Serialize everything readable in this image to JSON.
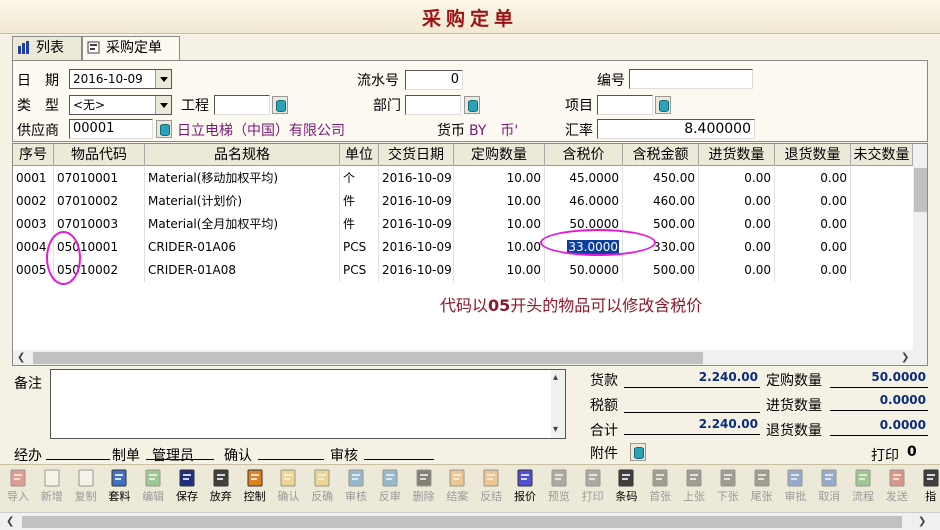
{
  "window": {
    "title": "采购定单"
  },
  "tabs": [
    {
      "label": "列表"
    },
    {
      "label": "采购定单"
    }
  ],
  "form": {
    "date_label": "日　期",
    "date_value": "2016-10-09",
    "serial_label": "流水号",
    "serial_value": "0",
    "number_label": "编号",
    "number_value": "",
    "type_label": "类　型",
    "type_value": "<无>",
    "project_label": "工程",
    "project_value": "",
    "dept_label": "部门",
    "dept_value": "",
    "item_label": "项目",
    "item_value": "",
    "supplier_label": "供应商",
    "supplier_code": "00001",
    "supplier_name": "日立电梯（中国）有限公司",
    "currency_label": "货币",
    "currency_value": "BY　币'",
    "rate_label": "汇率",
    "rate_value": "8.400000"
  },
  "grid": {
    "columns": [
      "序号",
      "物品代码",
      "品名规格",
      "单位",
      "交货日期",
      "定购数量",
      "含税价",
      "含税金额",
      "进货数量",
      "退货数量",
      "未交数量"
    ],
    "rows": [
      [
        "0001",
        "07010001",
        "Material(移动加权平均)",
        "个",
        "2016-10-09",
        "10.00",
        "45.0000",
        "450.00",
        "0.00",
        "0.00"
      ],
      [
        "0002",
        "07010002",
        "Material(计划价)",
        "件",
        "2016-10-09",
        "10.00",
        "46.0000",
        "460.00",
        "0.00",
        "0.00"
      ],
      [
        "0003",
        "07010003",
        "Material(全月加权平均)",
        "件",
        "2016-10-09",
        "10.00",
        "50.0000",
        "500.00",
        "0.00",
        "0.00"
      ],
      [
        "0004",
        "05010001",
        "CRIDER-01A06",
        "PCS",
        "2016-10-09",
        "10.00",
        "33.0000",
        "330.00",
        "0.00",
        "0.00"
      ],
      [
        "0005",
        "05010002",
        "CRIDER-01A08",
        "PCS",
        "2016-10-09",
        "10.00",
        "50.0000",
        "500.00",
        "0.00",
        "0.00"
      ]
    ],
    "annotation_pre": "代码以",
    "annotation_bold": "05",
    "annotation_post": "开头的物品可以修改含税价"
  },
  "footer": {
    "remarks_label": "备注",
    "payment_label": "货款",
    "payment_value": "2.240.00",
    "tax_label": "税额",
    "tax_value": "",
    "total_label": "合计",
    "total_value": "2.240.00",
    "attach_label": "附件",
    "ordered_qty_label": "定购数量",
    "ordered_qty_value": "50.0000",
    "received_qty_label": "进货数量",
    "received_qty_value": "0.0000",
    "returned_qty_label": "退货数量",
    "returned_qty_value": "0.0000",
    "handler_label": "经办",
    "maker_label": "制单",
    "maker_value": "管理员",
    "confirm_label": "确认",
    "audit_label": "审核",
    "print_label": "打印",
    "print_value": "0"
  },
  "toolbar": [
    {
      "label": "导入",
      "icon": "import-icon",
      "enabled": false,
      "color": "#d04040"
    },
    {
      "label": "新增",
      "icon": "new-file-icon",
      "enabled": false,
      "color": "#ffffff"
    },
    {
      "label": "复制",
      "icon": "copy-icon",
      "enabled": false,
      "color": "#ffffff"
    },
    {
      "label": "套料",
      "icon": "materials-icon",
      "enabled": true,
      "color": "#4070c0"
    },
    {
      "label": "编辑",
      "icon": "edit-icon",
      "enabled": false,
      "color": "#40a040"
    },
    {
      "label": "保存",
      "icon": "save-icon",
      "enabled": true,
      "color": "#203080"
    },
    {
      "label": "放弃",
      "icon": "undo-icon",
      "enabled": true,
      "color": "#404040"
    },
    {
      "label": "控制",
      "icon": "control-icon",
      "enabled": true,
      "color": "#e08020"
    },
    {
      "label": "确认",
      "icon": "confirm-icon",
      "enabled": false,
      "color": "#f0c040"
    },
    {
      "label": "反确",
      "icon": "unconfirm-icon",
      "enabled": false,
      "color": "#f0c040"
    },
    {
      "label": "审核",
      "icon": "audit-icon",
      "enabled": false,
      "color": "#3080c0"
    },
    {
      "label": "反审",
      "icon": "unaudit-icon",
      "enabled": false,
      "color": "#3080c0"
    },
    {
      "label": "删除",
      "icon": "delete-icon",
      "enabled": false,
      "color": "#000000"
    },
    {
      "label": "结案",
      "icon": "close-case-icon",
      "enabled": false,
      "color": "#f0a040"
    },
    {
      "label": "反结",
      "icon": "reopen-case-icon",
      "enabled": false,
      "color": "#f0a040"
    },
    {
      "label": "报价",
      "icon": "quote-icon",
      "enabled": true,
      "color": "#5050d0"
    },
    {
      "label": "预览",
      "icon": "preview-icon",
      "enabled": false,
      "color": "#606060"
    },
    {
      "label": "打印",
      "icon": "print-icon",
      "enabled": false,
      "color": "#606060"
    },
    {
      "label": "条码",
      "icon": "barcode-icon",
      "enabled": true,
      "color": "#404040"
    },
    {
      "label": "首张",
      "icon": "first-icon",
      "enabled": false,
      "color": "#404040"
    },
    {
      "label": "上张",
      "icon": "prev-icon",
      "enabled": false,
      "color": "#404040"
    },
    {
      "label": "下张",
      "icon": "next-icon",
      "enabled": false,
      "color": "#404040"
    },
    {
      "label": "尾张",
      "icon": "last-icon",
      "enabled": false,
      "color": "#404040"
    },
    {
      "label": "审批",
      "icon": "approve-icon",
      "enabled": false,
      "color": "#3060c0"
    },
    {
      "label": "取消",
      "icon": "cancel-icon",
      "enabled": false,
      "color": "#3060c0"
    },
    {
      "label": "流程",
      "icon": "flow-icon",
      "enabled": false,
      "color": "#40a040"
    },
    {
      "label": "发送",
      "icon": "send-icon",
      "enabled": false,
      "color": "#c03030"
    },
    {
      "label": "指",
      "icon": "more-icon",
      "enabled": true,
      "color": "#404040"
    }
  ]
}
